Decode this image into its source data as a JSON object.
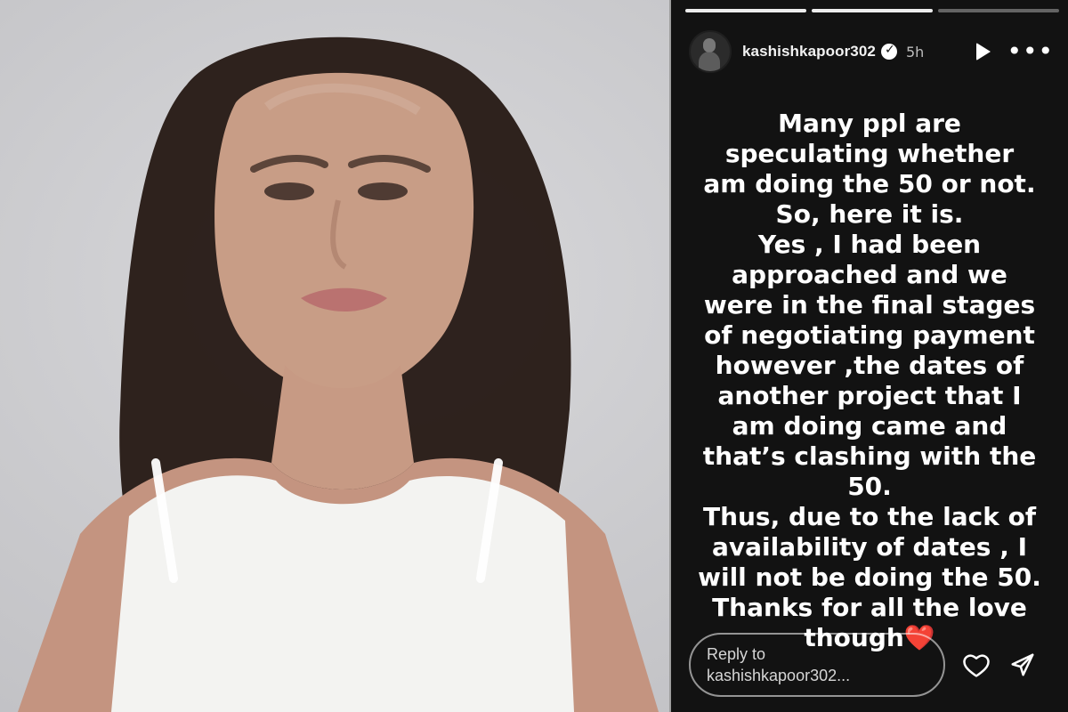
{
  "story": {
    "progress": {
      "segments_total": 3,
      "segments_done": 2
    },
    "header": {
      "username": "kashishkapoor302",
      "time": "5h",
      "icons": {
        "avatar": "profile-avatar",
        "verified": "verified-badge-icon",
        "play": "play-icon",
        "more": "more-icon"
      }
    },
    "message": {
      "text": "Many ppl are\nspeculating whether\nam doing the 50 or not.\nSo, here it is.\nYes , I had been\napproached and we\nwere in the final stages\nof negotiating payment\nhowever ,the dates of\nanother project that I\nam doing came and\nthat’s clashing with the\n50.\nThus, due to the lack of\navailability of dates , I\nwill not be doing the 50.\nThanks for all the love\nthough",
      "emoji": "❤️"
    },
    "reply": {
      "line1": "Reply to",
      "line2": "kashishkapoor302..."
    },
    "actions": {
      "like_icon": "heart-icon",
      "send_icon": "send-icon"
    }
  },
  "colors": {
    "story_bg": "#121212",
    "text": "#ffffff",
    "muted": "#bdbdbd",
    "accent_heart": "#e53935"
  }
}
